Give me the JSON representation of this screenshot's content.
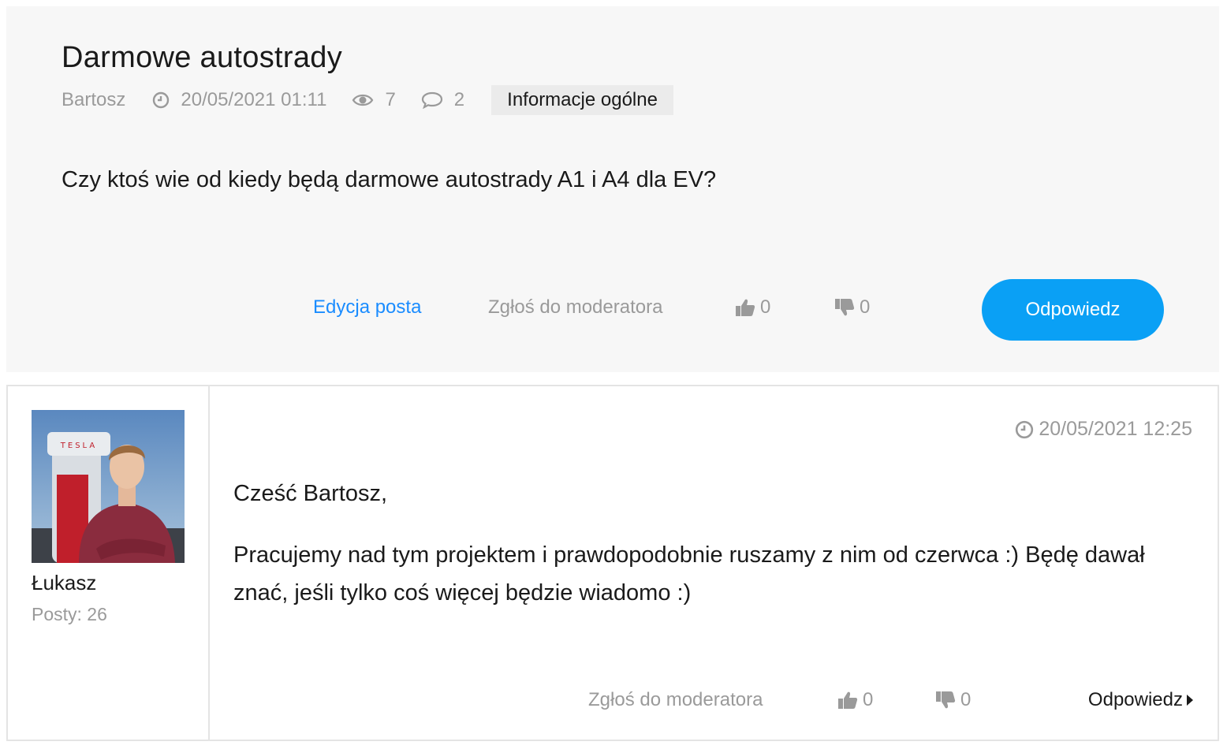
{
  "topic": {
    "title": "Darmowe autostrady",
    "author": "Bartosz",
    "date": "20/05/2021 01:11",
    "views": "7",
    "comments": "2",
    "category": "Informacje ogólne",
    "body": "Czy ktoś wie od kiedy będą darmowe autostrady A1 i A4 dla EV?",
    "actions": {
      "edit_label": "Edycja posta",
      "report_label": "Zgłoś do moderatora",
      "likes": "0",
      "dislikes": "0",
      "reply_label": "Odpowiedz"
    }
  },
  "reply": {
    "author": "Łukasz",
    "posts_label": "Posty: 26",
    "date": "20/05/2021 12:25",
    "body": [
      "Cześć Bartosz,",
      "Pracujemy nad tym projektem i prawdopodobnie ruszamy z nim od czerwca :) Będę dawał znać, jeśli tylko coś więcej będzie wiadomo :)"
    ],
    "actions": {
      "report_label": "Zgłoś do moderatora",
      "likes": "0",
      "dislikes": "0",
      "reply_label": "Odpowiedz"
    },
    "avatar_text": "TESLA"
  },
  "colors": {
    "accent": "#0aa0f5",
    "link": "#1a8cff",
    "muted": "#9a9a9a",
    "panel": "#f7f7f7"
  }
}
